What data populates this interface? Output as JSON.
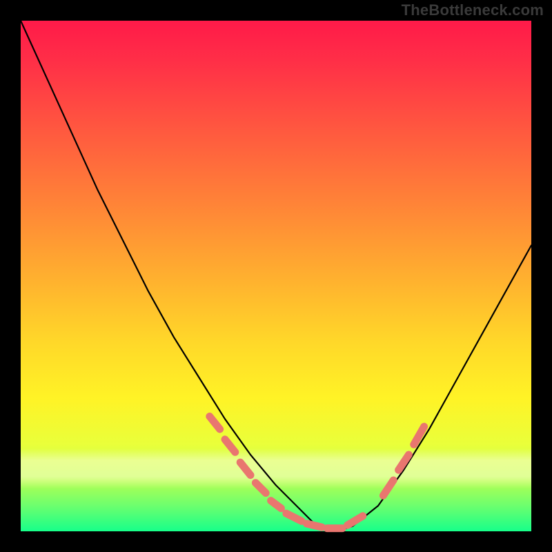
{
  "watermark": "TheBottleneck.com",
  "chart_data": {
    "type": "line",
    "title": "",
    "xlabel": "",
    "ylabel": "",
    "xlim": [
      0,
      100
    ],
    "ylim": [
      0,
      100
    ],
    "grid": false,
    "series": [
      {
        "name": "bottleneck-curve",
        "color": "#000000",
        "x": [
          0,
          5,
          10,
          15,
          20,
          25,
          30,
          35,
          40,
          45,
          50,
          55,
          58,
          62,
          65,
          70,
          75,
          80,
          85,
          90,
          95,
          100
        ],
        "values": [
          100,
          89,
          78,
          67,
          57,
          47,
          38,
          30,
          22,
          15,
          9,
          4,
          1,
          0,
          1,
          5,
          12,
          20,
          29,
          38,
          47,
          56
        ]
      }
    ],
    "markers": {
      "name": "highlight-dashes-left",
      "color": "#e9766f",
      "segments_left": [
        {
          "x1": 37,
          "y1": 22.5,
          "x2": 39,
          "y2": 20
        },
        {
          "x1": 40,
          "y1": 18,
          "x2": 42,
          "y2": 15.5
        },
        {
          "x1": 43,
          "y1": 13.5,
          "x2": 45,
          "y2": 11
        },
        {
          "x1": 46,
          "y1": 9.5,
          "x2": 48,
          "y2": 7.5
        },
        {
          "x1": 49,
          "y1": 6,
          "x2": 51,
          "y2": 4.5
        },
        {
          "x1": 52,
          "y1": 3.5,
          "x2": 55,
          "y2": 2
        },
        {
          "x1": 56,
          "y1": 1.5,
          "x2": 59,
          "y2": 0.8
        },
        {
          "x1": 60,
          "y1": 0.6,
          "x2": 63,
          "y2": 0.6
        },
        {
          "x1": 64,
          "y1": 1.2,
          "x2": 67,
          "y2": 3
        }
      ],
      "segments_right": [
        {
          "x1": 71,
          "y1": 7,
          "x2": 73,
          "y2": 10
        },
        {
          "x1": 74,
          "y1": 12,
          "x2": 76,
          "y2": 15
        },
        {
          "x1": 77,
          "y1": 17,
          "x2": 79,
          "y2": 20.5
        }
      ]
    }
  }
}
